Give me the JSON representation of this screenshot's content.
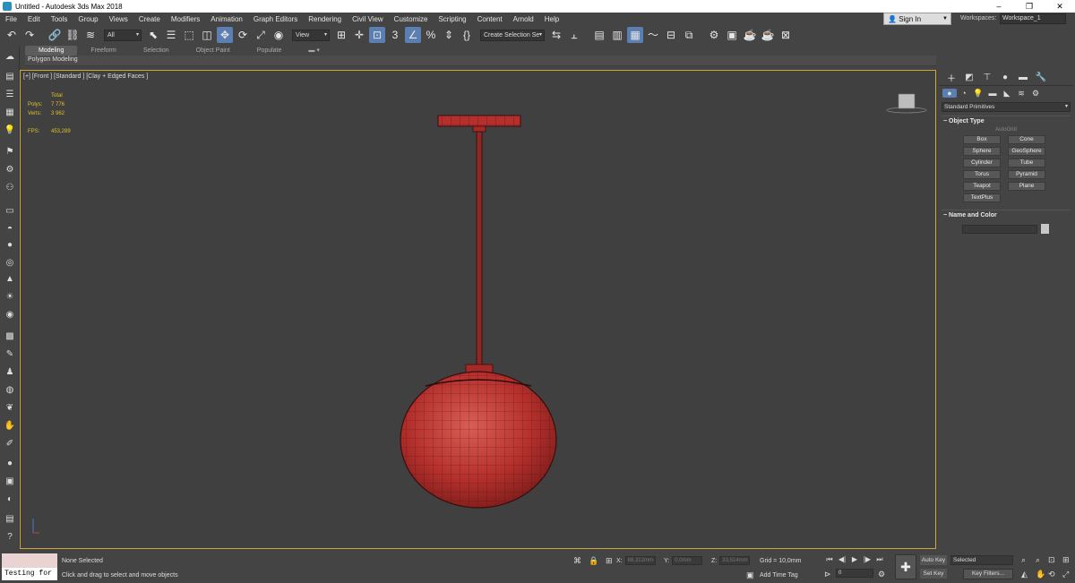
{
  "window": {
    "title": "Untitled - Autodesk 3ds Max 2018",
    "minimize": "–",
    "maximize": "❐",
    "close": "✕"
  },
  "menu": [
    "File",
    "Edit",
    "Tools",
    "Group",
    "Views",
    "Create",
    "Modifiers",
    "Animation",
    "Graph Editors",
    "Rendering",
    "Civil View",
    "Customize",
    "Scripting",
    "Content",
    "Arnold",
    "Help"
  ],
  "account": {
    "signin": "Sign In",
    "workspaces_label": "Workspaces:",
    "workspace": "Workspace_1"
  },
  "toolbar": {
    "selection_filter": "All",
    "ref_coord": "View",
    "named_sel": "Create Selection Se"
  },
  "ribbon": {
    "tabs": [
      "Modeling",
      "Freeform",
      "Selection",
      "Object Paint",
      "Populate"
    ],
    "active_tab": "Modeling",
    "sub_label": "Polygon Modeling"
  },
  "viewport": {
    "label": "[+] [Front ] [Standard ] [Clay + Edged Faces ]",
    "stats": {
      "total": "Total",
      "polys_label": "Polys:",
      "polys": "7 776",
      "verts_label": "Verts:",
      "verts": "3 962",
      "fps_label": "FPS:",
      "fps": "453,289"
    },
    "border_color": "#c9a93b",
    "object_color": "#b5302c"
  },
  "command_panel": {
    "category": "Standard Primitives",
    "object_type_title": "Object Type",
    "autogrid": "AutoGrid",
    "primitives": [
      "Box",
      "Cone",
      "Sphere",
      "GeoSphere",
      "Cylinder",
      "Tube",
      "Torus",
      "Pyramid",
      "Teapot",
      "Plane",
      "TextPlus"
    ],
    "name_color_title": "Name and Color"
  },
  "status": {
    "maxscript": "Testing for :",
    "selection": "None Selected",
    "hint": "Click and drag to select and move objects",
    "x_label": "X:",
    "x": "88,312mm",
    "y_label": "Y:",
    "y": "0,0mm",
    "z_label": "Z:",
    "z": "33,514mm",
    "grid": "Grid = 10,0mm",
    "time_tag": "Add Time Tag",
    "frame": "0",
    "auto_key": "Auto Key",
    "set_key": "Set Key",
    "key_mode": "Selected",
    "key_filters": "Key Filters..."
  }
}
